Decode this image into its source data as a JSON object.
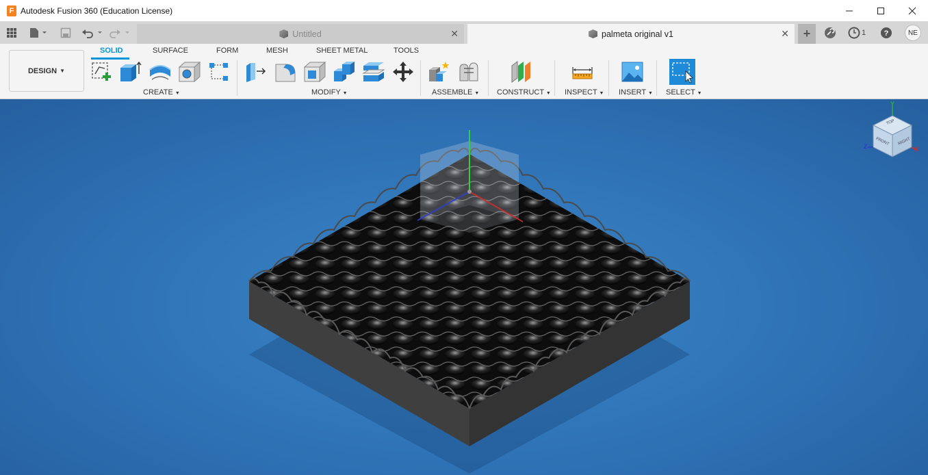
{
  "window": {
    "title": "Autodesk Fusion 360 (Education License)",
    "app_icon_letter": "F",
    "controls": [
      "minimize",
      "maximize",
      "close"
    ]
  },
  "tabs": [
    {
      "label": "Untitled",
      "active": false
    },
    {
      "label": "palmeta original v1",
      "active": true
    }
  ],
  "topbar": {
    "job_count": "1",
    "user_initials": "NE"
  },
  "workspace": {
    "label": "DESIGN"
  },
  "ribbon_tabs": [
    {
      "label": "SOLID",
      "active": true
    },
    {
      "label": "SURFACE",
      "active": false
    },
    {
      "label": "FORM",
      "active": false
    },
    {
      "label": "MESH",
      "active": false
    },
    {
      "label": "SHEET METAL",
      "active": false
    },
    {
      "label": "TOOLS",
      "active": false
    }
  ],
  "tool_groups": [
    {
      "label": "CREATE",
      "tools": [
        "create-sketch-icon",
        "extrude-icon",
        "revolve-icon",
        "hole-icon",
        "pattern-icon"
      ]
    },
    {
      "label": "MODIFY",
      "tools": [
        "press-pull-icon",
        "fillet-icon",
        "shell-icon",
        "combine-icon",
        "split-body-icon",
        "move-icon"
      ]
    },
    {
      "label": "ASSEMBLE",
      "tools": [
        "new-component-icon",
        "joint-icon"
      ]
    },
    {
      "label": "CONSTRUCT",
      "tools": [
        "offset-plane-icon"
      ]
    },
    {
      "label": "INSPECT",
      "tools": [
        "measure-icon"
      ]
    },
    {
      "label": "INSERT",
      "tools": [
        "insert-image-icon"
      ]
    },
    {
      "label": "SELECT",
      "tools": [
        "select-window-icon"
      ]
    }
  ],
  "viewcube": {
    "faces": [
      "TOP",
      "FRONT",
      "RIGHT"
    ],
    "axes": [
      "Y",
      "Z",
      "X"
    ]
  },
  "colors": {
    "accent": "#0696d7",
    "viewport": "#2d70b3",
    "model": "#3a3a3a"
  }
}
